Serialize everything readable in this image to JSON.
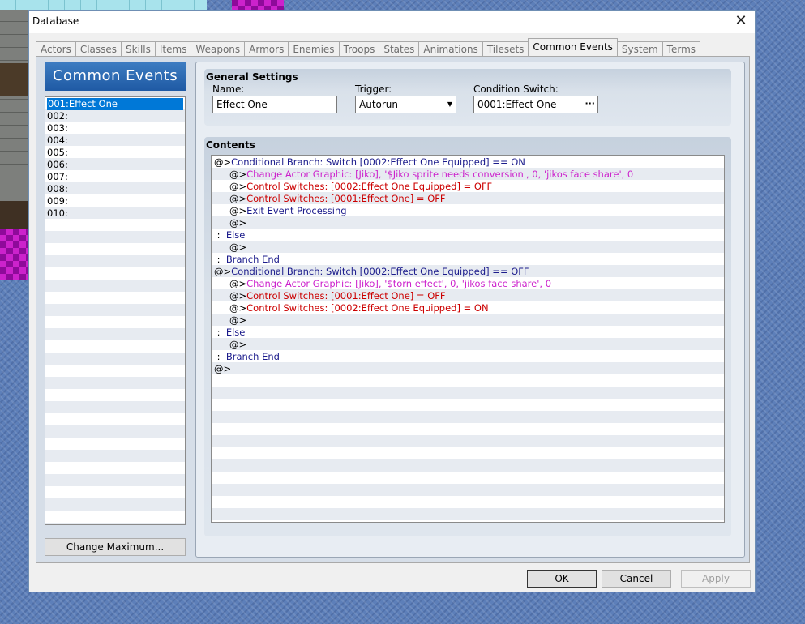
{
  "window": {
    "title": "Database",
    "close_glyph": "✕"
  },
  "tabs": [
    {
      "label": "Actors"
    },
    {
      "label": "Classes"
    },
    {
      "label": "Skills"
    },
    {
      "label": "Items"
    },
    {
      "label": "Weapons"
    },
    {
      "label": "Armors"
    },
    {
      "label": "Enemies"
    },
    {
      "label": "Troops"
    },
    {
      "label": "States"
    },
    {
      "label": "Animations"
    },
    {
      "label": "Tilesets"
    },
    {
      "label": "Common Events",
      "active": true
    },
    {
      "label": "System"
    },
    {
      "label": "Terms"
    }
  ],
  "left_panel": {
    "header": "Common Events",
    "events": [
      {
        "label": "001:Effect One",
        "selected": true
      },
      {
        "label": "002:"
      },
      {
        "label": "003:"
      },
      {
        "label": "004:"
      },
      {
        "label": "005:"
      },
      {
        "label": "006:"
      },
      {
        "label": "007:"
      },
      {
        "label": "008:"
      },
      {
        "label": "009:"
      },
      {
        "label": "010:"
      }
    ],
    "change_max_label": "Change Maximum..."
  },
  "general_settings": {
    "title": "General Settings",
    "name_label": "Name:",
    "name_value": "Effect One",
    "trigger_label": "Trigger:",
    "trigger_value": "Autorun",
    "condition_label": "Condition Switch:",
    "condition_value": "0001:Effect One",
    "condition_button_icon": "ellipsis-icon"
  },
  "contents": {
    "title": "Contents",
    "commands": [
      {
        "indent": 0,
        "prefix": "@>",
        "text": "Conditional Branch: Switch [0002:Effect One Equipped] == ON",
        "color": "#1c1c8c"
      },
      {
        "indent": 1,
        "prefix": "@>",
        "text": "Change Actor Graphic: [Jiko], '$Jiko sprite needs conversion', 0, 'jikos face share', 0",
        "color": "#cc22cc"
      },
      {
        "indent": 1,
        "prefix": "@>",
        "text": "Control Switches: [0002:Effect One Equipped] = OFF",
        "color": "#cc0000"
      },
      {
        "indent": 1,
        "prefix": "@>",
        "text": "Control Switches: [0001:Effect One] = OFF",
        "color": "#cc0000"
      },
      {
        "indent": 1,
        "prefix": "@>",
        "text": "Exit Event Processing",
        "color": "#1c1c8c"
      },
      {
        "indent": 1,
        "prefix": "@>",
        "text": "",
        "color": "#000000"
      },
      {
        "indent": 0,
        "prefix": " :  ",
        "text": "Else",
        "color": "#1c1c8c"
      },
      {
        "indent": 1,
        "prefix": "@>",
        "text": "",
        "color": "#000000"
      },
      {
        "indent": 0,
        "prefix": " :  ",
        "text": "Branch End",
        "color": "#1c1c8c"
      },
      {
        "indent": 0,
        "prefix": "@>",
        "text": "Conditional Branch: Switch [0002:Effect One Equipped] == OFF",
        "color": "#1c1c8c"
      },
      {
        "indent": 1,
        "prefix": "@>",
        "text": "Change Actor Graphic: [Jiko], '$torn effect', 0, 'jikos face share', 0",
        "color": "#cc22cc"
      },
      {
        "indent": 1,
        "prefix": "@>",
        "text": "Control Switches: [0001:Effect One] = OFF",
        "color": "#cc0000"
      },
      {
        "indent": 1,
        "prefix": "@>",
        "text": "Control Switches: [0002:Effect One Equipped] = ON",
        "color": "#cc0000"
      },
      {
        "indent": 1,
        "prefix": "@>",
        "text": "",
        "color": "#000000"
      },
      {
        "indent": 0,
        "prefix": " :  ",
        "text": "Else",
        "color": "#1c1c8c"
      },
      {
        "indent": 1,
        "prefix": "@>",
        "text": "",
        "color": "#000000"
      },
      {
        "indent": 0,
        "prefix": " :  ",
        "text": "Branch End",
        "color": "#1c1c8c"
      },
      {
        "indent": 0,
        "prefix": "@>",
        "text": "",
        "color": "#000000"
      }
    ]
  },
  "buttons": {
    "ok": "OK",
    "cancel": "Cancel",
    "apply": "Apply"
  }
}
